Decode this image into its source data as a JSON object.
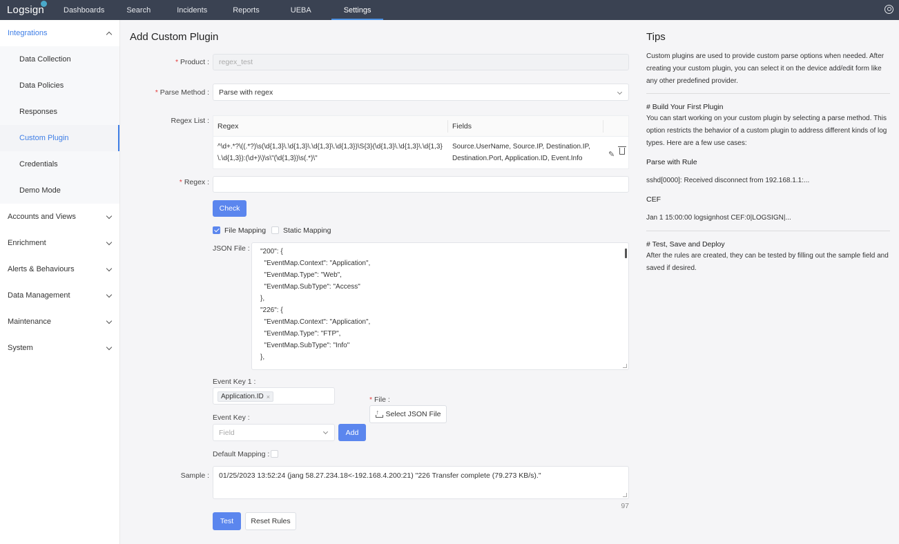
{
  "nav": {
    "logo": "Logsign",
    "items": [
      "Dashboards",
      "Search",
      "Incidents",
      "Reports",
      "UEBA",
      "Settings"
    ],
    "active": "Settings"
  },
  "sidebar": {
    "integrations": {
      "label": "Integrations",
      "items": [
        "Data Collection",
        "Data Policies",
        "Responses",
        "Custom Plugin",
        "Credentials",
        "Demo Mode"
      ],
      "active": "Custom Plugin"
    },
    "groups": [
      "Accounts and Views",
      "Enrichment",
      "Alerts & Behaviours",
      "Data Management",
      "Maintenance",
      "System"
    ]
  },
  "form": {
    "title": "Add Custom Plugin",
    "product_label": "Product :",
    "product_value": "regex_test",
    "parse_method_label": "Parse Method :",
    "parse_method_value": "Parse with regex",
    "regex_list_label": "Regex List :",
    "regex_table": {
      "col_regex": "Regex",
      "col_fields": "Fields",
      "row_regex": "^\\d+.*?\\((.*?)\\s(\\d{1,3}\\.\\d{1,3}\\.\\d{1,3}\\.\\d{1,3})\\S{3}(\\d{1,3}\\.\\d{1,3}\\.\\d{1,3}\\.\\d{1,3}):(\\d+)\\)\\s\\\"(\\d{1,3})\\s(.*)\\\"",
      "row_fields": "Source.UserName, Source.IP, Destination.IP, Destination.Port, Application.ID, Event.Info"
    },
    "regex_label": "Regex :",
    "check_button": "Check",
    "file_mapping_label": "File Mapping",
    "static_mapping_label": "Static Mapping",
    "json_file_label": "JSON File :",
    "json_lines": [
      "\"200\": {",
      "  \"EventMap.Context\": \"Application\",",
      "  \"EventMap.Type\": \"Web\",",
      "  \"EventMap.SubType\": \"Access\"",
      "},",
      "\"226\": {",
      "  \"EventMap.Context\": \"Application\",",
      "  \"EventMap.Type\": \"FTP\",",
      "  \"EventMap.SubType\": \"Info\"",
      "},"
    ],
    "event_key_1_label": "Event Key 1 :",
    "event_key_1_tag": "Application.ID",
    "file_label": "File :",
    "select_json_button": "Select JSON File",
    "event_key_label": "Event Key :",
    "field_placeholder": "Field",
    "add_button": "Add",
    "default_mapping_label": "Default Mapping :",
    "sample_label": "Sample :",
    "sample_value": "01/25/2023 13:52:24 (jang 58.27.234.18<-192.168.4.200:21) \"226 Transfer complete (79.273 KB/s).\"",
    "sample_count": "97",
    "test_button": "Test",
    "reset_button": "Reset Rules"
  },
  "tips": {
    "title": "Tips",
    "intro": "Custom plugins are used to provide custom parse options when needed. After creating your custom plugin, you can select it on the device add/edit form like any other predefined provider.",
    "build_head": "# Build Your First Plugin",
    "build_text": "You can start working on your custom plugin by selecting a parse method. This option restricts the behavior of a custom plugin to address different kinds of log types. Here are a few use cases:",
    "rule_head": "Parse with Rule",
    "rule_text": "sshd[0000]: Received disconnect from 192.168.1.1:...",
    "cef_head": "CEF",
    "cef_text": "Jan 1 15:00:00 logsignhost CEF:0|LOGSIGN|...",
    "test_head": "# Test, Save and Deploy",
    "test_text": "After the rules are created, they can be tested by filling out the sample field and saved if desired."
  },
  "colors": {
    "accent": "#5b86ee",
    "nav_bg": "#3a4252",
    "link": "#3e7ee6"
  }
}
